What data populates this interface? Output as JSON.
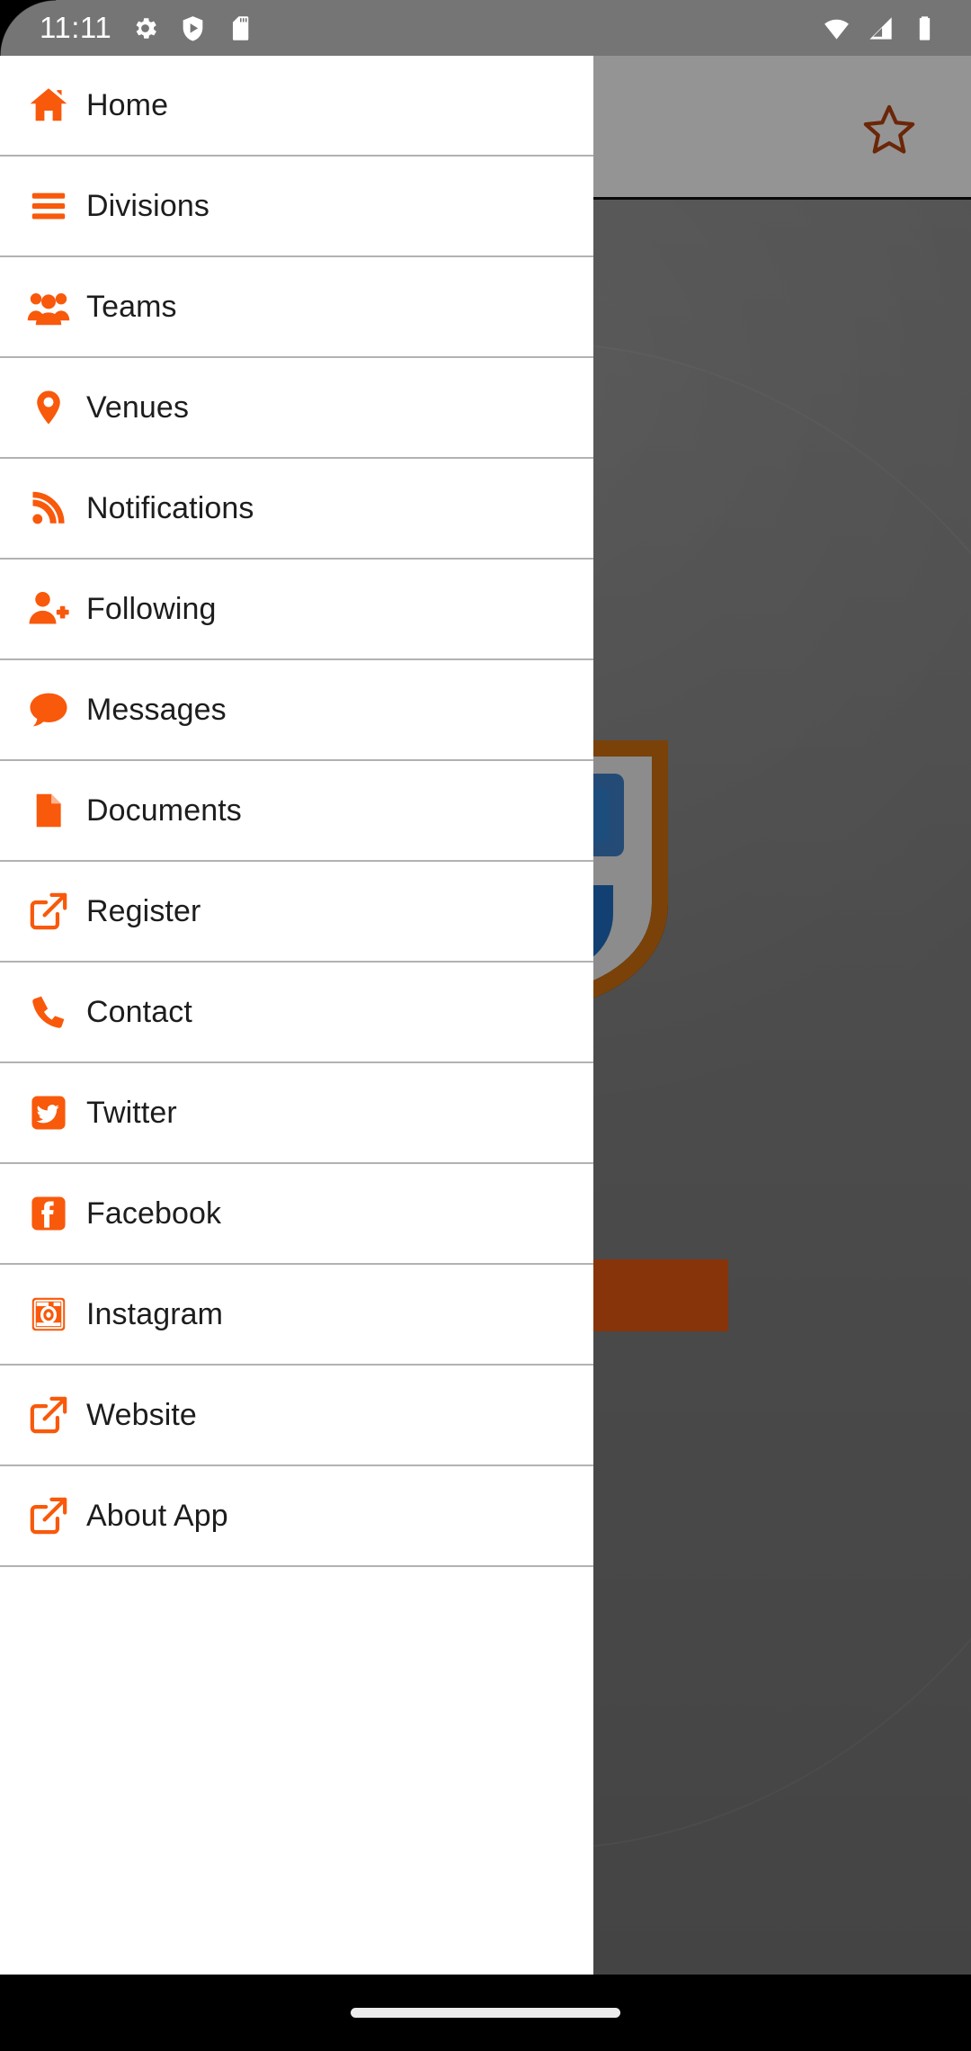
{
  "status_bar": {
    "time": "11:11",
    "left_icons": [
      "gear-icon",
      "shield-play-icon",
      "sd-card-icon"
    ],
    "right_icons": [
      "wifi-icon",
      "cell-signal-icon",
      "battery-icon"
    ],
    "background_color": "#757575"
  },
  "theme": {
    "accent": "#F8590B",
    "drawer_background": "#FFFFFF",
    "divider": "#B2B2B2",
    "label_color": "#1D1D1D"
  },
  "drawer": {
    "items": [
      {
        "label": "Home",
        "icon": "home-icon"
      },
      {
        "label": "Divisions",
        "icon": "list-bars-icon"
      },
      {
        "label": "Teams",
        "icon": "users-group-icon"
      },
      {
        "label": "Venues",
        "icon": "map-pin-icon"
      },
      {
        "label": "Notifications",
        "icon": "rss-feed-icon"
      },
      {
        "label": "Following",
        "icon": "user-plus-icon"
      },
      {
        "label": "Messages",
        "icon": "speech-bubble-icon"
      },
      {
        "label": "Documents",
        "icon": "document-icon"
      },
      {
        "label": "Register",
        "icon": "external-link-icon"
      },
      {
        "label": "Contact",
        "icon": "phone-icon"
      },
      {
        "label": "Twitter",
        "icon": "twitter-icon"
      },
      {
        "label": "Facebook",
        "icon": "facebook-icon"
      },
      {
        "label": "Instagram",
        "icon": "instagram-icon"
      },
      {
        "label": "Website",
        "icon": "external-link-icon"
      },
      {
        "label": "About App",
        "icon": "external-link-icon"
      }
    ]
  },
  "background_app": {
    "app_bar": {
      "favorite_icon": "star-outline-icon",
      "favorite_color": "#B8430E"
    },
    "crest": "club-crest-badge",
    "action_button_color": "#8C3408"
  },
  "navigation_bar": {
    "handle": "gesture-pill"
  }
}
